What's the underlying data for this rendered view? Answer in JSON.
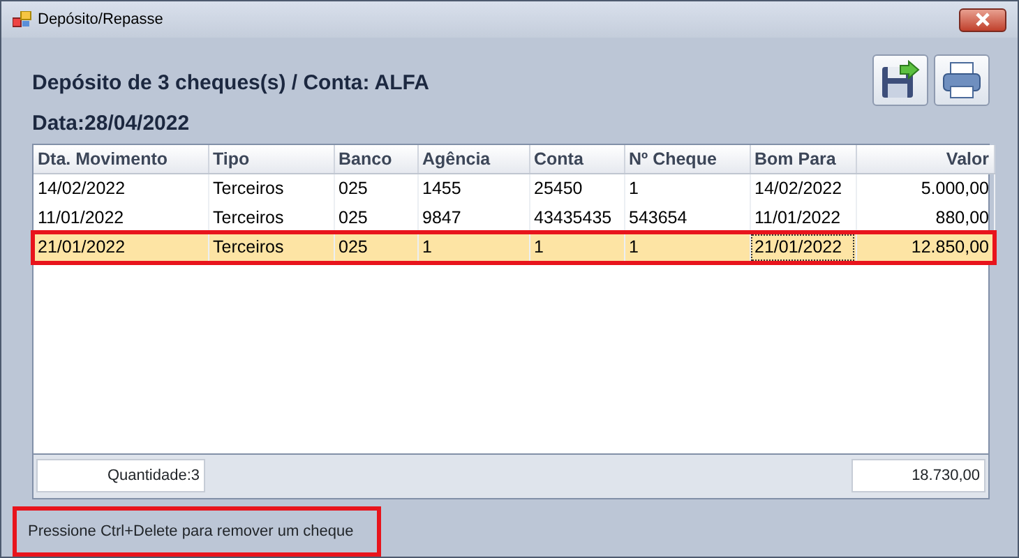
{
  "window": {
    "title": "Depósito/Repasse"
  },
  "heading": "Depósito de 3 cheques(s) / Conta: ALFA",
  "date_label": "Data:28/04/2022",
  "table": {
    "columns": [
      "Dta. Movimento",
      "Tipo",
      "Banco",
      "Agência",
      "Conta",
      "Nº Cheque",
      "Bom Para",
      "Valor"
    ],
    "rows": [
      {
        "selected": false,
        "outlined": false,
        "cells": [
          "14/02/2022",
          "Terceiros",
          "025",
          "1455",
          "25450",
          "1",
          "14/02/2022",
          "5.000,00"
        ]
      },
      {
        "selected": false,
        "outlined": false,
        "cells": [
          "11/01/2022",
          "Terceiros",
          "025",
          "9847",
          "43435435",
          "543654",
          "11/01/2022",
          "880,00"
        ]
      },
      {
        "selected": true,
        "outlined": true,
        "cells": [
          "21/01/2022",
          "Terceiros",
          "025",
          "1",
          "1",
          "1",
          "21/01/2022",
          "12.850,00"
        ]
      }
    ]
  },
  "footer": {
    "count": "Quantidade:3",
    "total": "18.730,00"
  },
  "status": {
    "text": "Pressione Ctrl+Delete para remover um cheque",
    "outlined": true
  }
}
